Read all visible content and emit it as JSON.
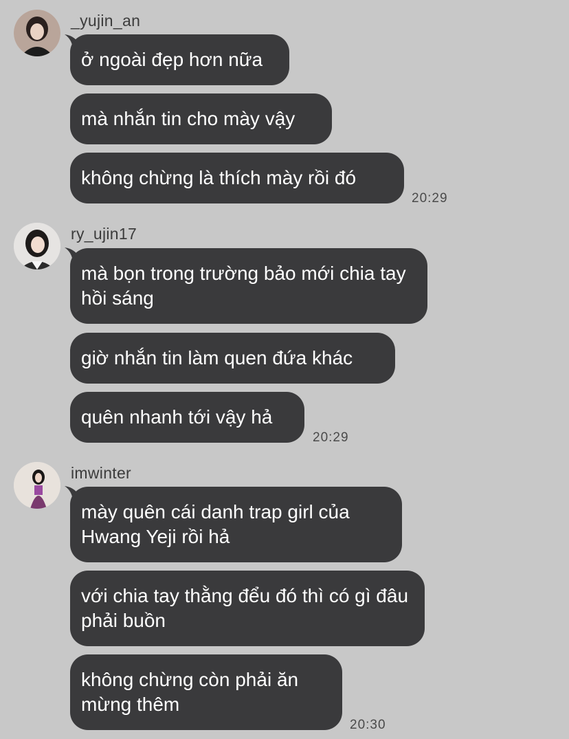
{
  "groups": [
    {
      "username": "_yujin_an",
      "avatar_icon": "user-avatar-icon",
      "messages": [
        "ở ngoài đẹp hơn nữa",
        "mà nhắn tin cho mày vậy",
        "không chừng là thích mày rồi đó"
      ],
      "time": "20:29"
    },
    {
      "username": "ry_ujin17",
      "avatar_icon": "user-avatar-icon",
      "messages": [
        "mà bọn trong trường bảo mới chia tay hồi sáng",
        "giờ nhắn tin làm quen đứa khác",
        "quên nhanh tới vậy hả"
      ],
      "time": "20:29"
    },
    {
      "username": "imwinter",
      "avatar_icon": "user-avatar-icon",
      "messages": [
        "mày quên cái danh trap girl của Hwang Yeji rồi hả",
        "với chia tay thằng đểu đó thì có gì đâu phải buồn",
        "không chừng còn phải ăn mừng thêm"
      ],
      "time": "20:30"
    }
  ],
  "colors": {
    "background": "#c8c8c8",
    "bubble": "#3a3a3c",
    "bubble_text": "#ffffff",
    "username": "#3c3c3c",
    "timestamp": "#4a4a4a"
  }
}
